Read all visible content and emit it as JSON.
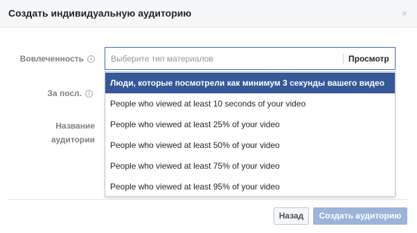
{
  "dialog": {
    "title": "Создать индивидуальную аудиторию",
    "close_glyph": "×"
  },
  "form": {
    "engagement_label": "Вовлеченность",
    "period_label": "За посл.",
    "audience_name_label_line1": "Название",
    "audience_name_label_line2": "аудитории",
    "info_glyph": "i"
  },
  "content_select": {
    "placeholder": "Выберите тип материалов",
    "browse_label": "Просмотр"
  },
  "dropdown": {
    "options": [
      {
        "label": "Люди, которые посмотрели как минимум 3 секунды вашего видео",
        "selected": true
      },
      {
        "label": "People who viewed at least 10 seconds of your video",
        "selected": false
      },
      {
        "label": "People who viewed at least 25% of your video",
        "selected": false
      },
      {
        "label": "People who viewed at least 50% of your video",
        "selected": false
      },
      {
        "label": "People who viewed at least 75% of your video",
        "selected": false
      },
      {
        "label": "People who viewed at least 95% of your video",
        "selected": false
      }
    ]
  },
  "footer": {
    "back_label": "Назад",
    "create_label": "Создать аудиторию"
  },
  "colors": {
    "selected_option_bg": "#365899",
    "primary_button_disabled": "#9cb4d8",
    "header_bg": "#f6f7f9"
  }
}
